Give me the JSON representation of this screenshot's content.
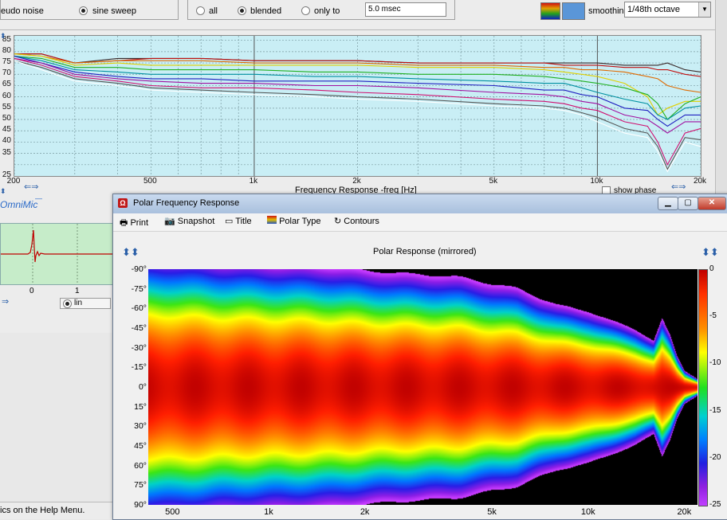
{
  "main": {
    "signal": {
      "pseudo_noise": "eudo noise",
      "sine_sweep": "sine sweep"
    },
    "window_opts": {
      "all": "all",
      "blended": "blended",
      "only_to": "only to",
      "time_value": "5.0 msec"
    },
    "smoothing": {
      "label": "smoothing",
      "value": "1/48th octave"
    },
    "plot_x_label": "Frequency Response -freq [Hz]",
    "show_phase": "show phase",
    "omnimic": "OmniMic",
    "impulse_ticks": [
      "0",
      "1"
    ],
    "lin": "lin",
    "help_status": "ics on the Help Menu."
  },
  "polar": {
    "window_title": "Polar Frequency Response",
    "menu": [
      "Print",
      "Snapshot",
      "Title",
      "Polar Type",
      "Contours"
    ],
    "plot_title": "Polar Response (mirrored)",
    "colorbar_ticks": [
      "0",
      "-5",
      "-10",
      "-15",
      "-20",
      "-25"
    ]
  },
  "chart_data": [
    {
      "type": "line",
      "title": "",
      "xlabel": "Frequency Response -freq [Hz]",
      "ylabel": "",
      "xscale": "log",
      "x_ticks": [
        "200",
        "500",
        "1k",
        "2k",
        "5k",
        "10k",
        "20k"
      ],
      "y_ticks": [
        "85",
        "80",
        "75",
        "70",
        "65",
        "60",
        "55",
        "50",
        "45",
        "40",
        "35",
        "25"
      ],
      "xlim": [
        200,
        20000
      ],
      "ylim": [
        25,
        87
      ],
      "x": [
        200,
        240,
        300,
        400,
        500,
        700,
        1000,
        1500,
        2000,
        3000,
        5000,
        7000,
        8000,
        9000,
        10000,
        12000,
        14000,
        15000,
        16000,
        18000,
        20000
      ],
      "series": [
        {
          "color": "#3a2a2a",
          "values": [
            79,
            79,
            75,
            77,
            77,
            77,
            76,
            76,
            76,
            75,
            75,
            75,
            75,
            75,
            75,
            74,
            74,
            74,
            75,
            72,
            71
          ]
        },
        {
          "color": "#c01010",
          "values": [
            79,
            79,
            75,
            76,
            77,
            77,
            76,
            76,
            76,
            75,
            75,
            75,
            74,
            74,
            74,
            73,
            73,
            72,
            72,
            70,
            69
          ]
        },
        {
          "color": "#e06a00",
          "values": [
            79,
            78,
            75,
            76,
            76,
            76,
            75,
            75,
            75,
            74,
            74,
            73,
            73,
            72,
            72,
            71,
            69,
            68,
            65,
            63,
            62
          ]
        },
        {
          "color": "#e0d000",
          "values": [
            79,
            78,
            74,
            75,
            74,
            74,
            74,
            74,
            74,
            73,
            73,
            72,
            71,
            70,
            69,
            66,
            60,
            52,
            55,
            58,
            58
          ]
        },
        {
          "color": "#20b020",
          "values": [
            78,
            77,
            73,
            73,
            72,
            72,
            72,
            71,
            71,
            70,
            70,
            69,
            68,
            67,
            66,
            64,
            61,
            57,
            50,
            57,
            60
          ]
        },
        {
          "color": "#0090a0",
          "values": [
            78,
            76,
            72,
            71,
            70,
            70,
            70,
            69,
            69,
            68,
            67,
            66,
            66,
            64,
            62,
            59,
            57,
            52,
            50,
            55,
            56
          ]
        },
        {
          "color": "#2020c0",
          "values": [
            78,
            75,
            71,
            69,
            68,
            68,
            67,
            67,
            67,
            66,
            65,
            63,
            63,
            61,
            60,
            55,
            54,
            50,
            47,
            52,
            52
          ]
        },
        {
          "color": "#a010a0",
          "values": [
            77,
            75,
            70,
            68,
            67,
            66,
            66,
            65,
            65,
            64,
            62,
            61,
            60,
            58,
            57,
            52,
            50,
            47,
            44,
            49,
            49
          ]
        },
        {
          "color": "#d01070",
          "values": [
            77,
            74,
            69,
            67,
            65,
            64,
            64,
            63,
            62,
            61,
            59,
            58,
            57,
            55,
            54,
            49,
            47,
            40,
            30,
            44,
            46
          ]
        },
        {
          "color": "#555555",
          "values": [
            76,
            73,
            68,
            66,
            64,
            63,
            62,
            61,
            60,
            59,
            57,
            56,
            55,
            53,
            51,
            46,
            44,
            38,
            28,
            42,
            41
          ]
        },
        {
          "color": "#ffffff",
          "values": [
            76,
            72,
            67,
            65,
            63,
            62,
            61,
            60,
            59,
            58,
            56,
            55,
            54,
            52,
            49,
            44,
            42,
            36,
            27,
            40,
            38
          ]
        }
      ]
    },
    {
      "type": "heatmap",
      "title": "Polar Response (mirrored)",
      "x_ticks": [
        "500",
        "1k",
        "2k",
        "5k",
        "10k",
        "20k"
      ],
      "y_ticks": [
        "-90°",
        "-75°",
        "-60°",
        "-45°",
        "-30°",
        "-15°",
        "0°",
        "15°",
        "30°",
        "45°",
        "60°",
        "75°",
        "90°"
      ],
      "xlim": [
        420,
        22000
      ],
      "ylim": [
        -90,
        90
      ],
      "colorbar": {
        "min": -25,
        "max": 0
      },
      "beamwidth_freqs": [
        420,
        500,
        700,
        1000,
        1500,
        2000,
        2500,
        3000,
        4000,
        5000,
        6000,
        7000,
        8000,
        10000,
        12000,
        14000,
        16000,
        17000,
        18000,
        19000,
        20000,
        22000
      ],
      "beamwidth_deg": [
        95,
        95,
        92,
        90,
        88,
        85,
        83,
        82,
        80,
        75,
        72,
        65,
        60,
        55,
        48,
        42,
        34,
        50,
        38,
        22,
        12,
        6
      ]
    }
  ]
}
